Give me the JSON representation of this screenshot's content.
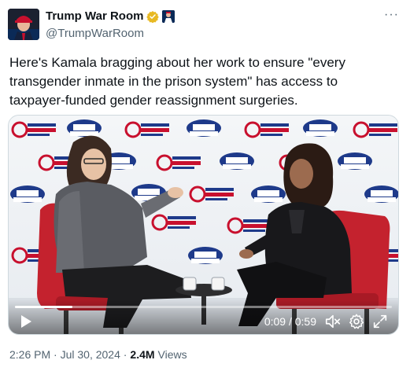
{
  "author": {
    "display_name": "Trump War Room",
    "handle": "@TrumpWarRoom",
    "verified_color": "#e8b923",
    "affiliate_badge": "affiliate-badge-icon",
    "avatar": "avatar-icon"
  },
  "tweet": {
    "text": "Here's Kamala bragging about her work to ensure \"every transgender inmate in the prison system\" has access to taxpayer-funded gender reassignment surgeries."
  },
  "video": {
    "time_display": "0:09 / 0:59",
    "progress_fraction": 0.153,
    "icons": {
      "play": "play-icon",
      "mute": "volume-muted-icon",
      "settings": "settings-icon",
      "fullscreen": "fullscreen-icon"
    },
    "backdrop_logos": {
      "transform_top": "TRANSFORM",
      "transform_bottom": "THE WHITE HOUSE",
      "equality_top": "TRANSGENDER",
      "equality_mid": "EQUALITY",
      "equality_bottom": "ACTION FUND"
    }
  },
  "meta": {
    "timestamp": "2:26 PM · Jul 30, 2024 ·",
    "views_count": "2.4M",
    "views_label": "Views"
  },
  "more_label": "···"
}
